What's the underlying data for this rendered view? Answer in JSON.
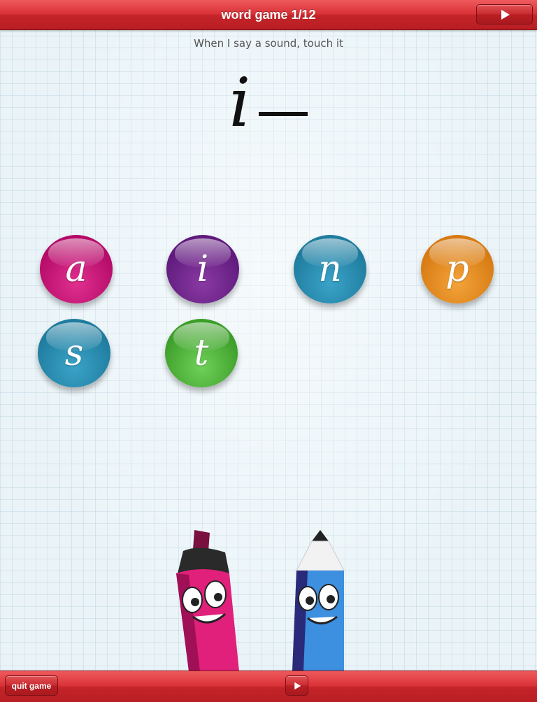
{
  "header": {
    "title": "word game 1/12",
    "next_icon": "play-icon"
  },
  "instruction": "When I say a sound, touch it",
  "word": {
    "letter": "i"
  },
  "letters": [
    "a",
    "i",
    "n",
    "p",
    "s",
    "t"
  ],
  "colors": {
    "bar": "#d93136",
    "a": "#c8177a",
    "i": "#6e2a8c",
    "n": "#2a8fb5",
    "p": "#e68f22",
    "s": "#2a8fb5",
    "t": "#52b83c"
  },
  "footer": {
    "quit_label": "quit game",
    "play_icon": "play-icon"
  }
}
